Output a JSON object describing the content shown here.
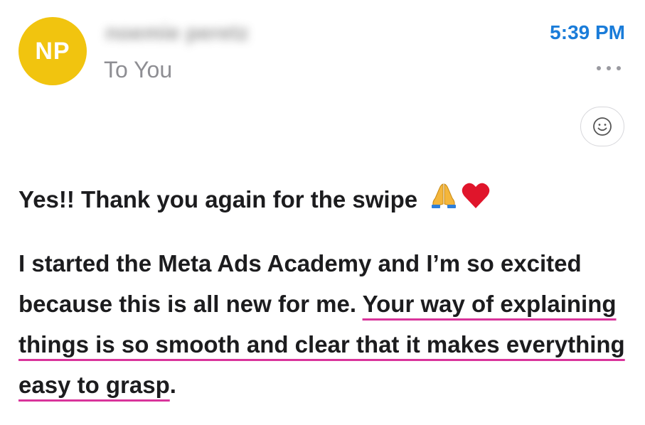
{
  "header": {
    "avatar_initials": "NP",
    "avatar_color": "#f1c40f",
    "sender_name": "noemie peretz",
    "recipient_label": "To You",
    "timestamp": "5:39 PM",
    "timestamp_color": "#1a7cd9",
    "more_icon": "more-horizontal-icon",
    "reaction_icon": "smiley-face-icon"
  },
  "message": {
    "line1_text": "Yes!! Thank you again for the swipe",
    "line1_emojis": [
      "folded-hands-emoji",
      "red-heart-emoji"
    ],
    "para2_plain": "I started the Meta Ads Academy and I’m so excited because this is all new for me. ",
    "para2_highlighted": "Your way of explaining things is so smooth and clear that it makes everything easy to grasp",
    "para2_end": ".",
    "highlight_color": "#d9349b"
  }
}
